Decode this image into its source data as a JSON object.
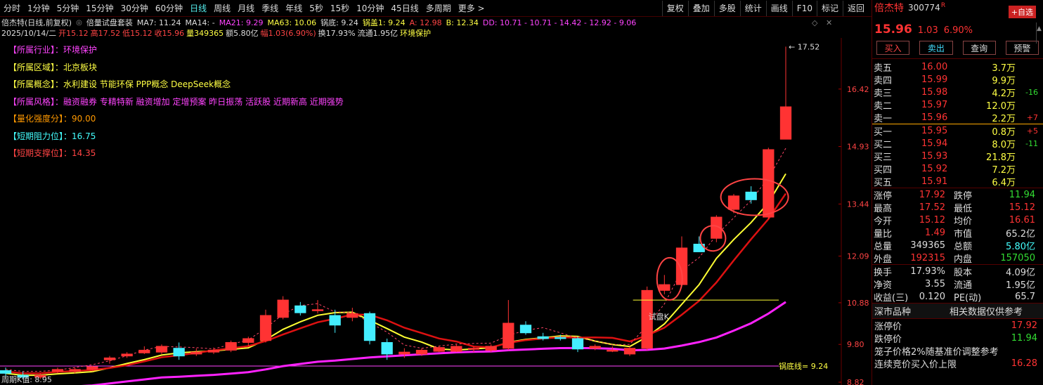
{
  "toolbar": {
    "periods": [
      "分时",
      "1分钟",
      "5分钟",
      "15分钟",
      "30分钟",
      "60分钟",
      "日线",
      "周线",
      "月线",
      "季线",
      "年线",
      "5秒",
      "15秒",
      "10分钟",
      "45日线",
      "多周期",
      "更多 >"
    ],
    "active": "日线",
    "right_items": [
      "复权",
      "叠加",
      "多股",
      "统计",
      "画线",
      "F10",
      "标记",
      "返回"
    ]
  },
  "title_line": {
    "stock": "倍杰特(日线,前复权)",
    "indicator": "倍量试盘套装",
    "ma7": "MA7: 11.24",
    "ma14": "MA14: -",
    "ma21": "MA21: 9.29",
    "ma63": "MA63: 10.06",
    "guodi": "锅底: 9.24",
    "guogai": "锅盖1: 9.24",
    "a": "A: 12.98",
    "b": "B: 12.34",
    "dd": "DD: 10.71 - 10.71 - 14.42 - 12.92 - 9.06"
  },
  "ohlc_line": {
    "date": "2025/10/14/二",
    "open": "开15.12",
    "high": "高17.52",
    "low": "低15.12",
    "close": "收15.96",
    "volume": "量349365",
    "amount": "额5.80亿",
    "change": "幅1.03(6.90%)",
    "turnover": "换17.93%",
    "float": "流通1.95亿",
    "industry": "环境保护"
  },
  "tags": [
    {
      "label": "【所属行业】：",
      "value": "环境保护",
      "color": "#ff44ff"
    },
    {
      "label": "【所属区域】：",
      "value": "北京板块",
      "color": "#ffff44"
    },
    {
      "label": "【所属概念】：",
      "value": "水利建设 节能环保 PPP概念 DeepSeek概念",
      "color": "#ffff44"
    },
    {
      "label": "【所属风格】：",
      "value": "融资融券 专精特新 融资增加 定增预案 昨日振荡 活跃股 近期新高 近期强势",
      "color": "#ff44ff"
    },
    {
      "label": "【量化强度分】：",
      "value": "90.00",
      "color": "#ff9900"
    },
    {
      "label": "【短期阻力位】：",
      "value": "16.75",
      "color": "#44ffff"
    },
    {
      "label": "【短期支撑位】：",
      "value": "14.35",
      "color": "#ff4444"
    }
  ],
  "chart_data": {
    "type": "candlestick",
    "ylim": [
      8.82,
      17.6
    ],
    "y_ticks": [
      "16.42",
      "14.93",
      "13.44",
      "12.09",
      "10.88",
      "9.80",
      "8.82"
    ],
    "candles": [
      {
        "o": 9.12,
        "h": 9.2,
        "l": 8.98,
        "c": 9.05
      },
      {
        "o": 9.0,
        "h": 9.1,
        "l": 8.9,
        "c": 8.95
      },
      {
        "o": 8.95,
        "h": 9.05,
        "l": 8.9,
        "c": 9.0
      },
      {
        "o": 9.1,
        "h": 9.2,
        "l": 9.05,
        "c": 9.15
      },
      {
        "o": 9.1,
        "h": 9.2,
        "l": 9.05,
        "c": 9.15
      },
      {
        "o": 9.15,
        "h": 9.25,
        "l": 9.1,
        "c": 9.22
      },
      {
        "o": 9.4,
        "h": 9.5,
        "l": 9.3,
        "c": 9.45
      },
      {
        "o": 9.5,
        "h": 9.6,
        "l": 9.45,
        "c": 9.55
      },
      {
        "o": 9.58,
        "h": 9.75,
        "l": 9.55,
        "c": 9.65
      },
      {
        "o": 9.6,
        "h": 9.8,
        "l": 9.55,
        "c": 9.75
      },
      {
        "o": 9.7,
        "h": 9.85,
        "l": 9.4,
        "c": 9.5
      },
      {
        "o": 9.55,
        "h": 9.7,
        "l": 9.5,
        "c": 9.6
      },
      {
        "o": 9.6,
        "h": 9.72,
        "l": 9.55,
        "c": 9.65
      },
      {
        "o": 9.65,
        "h": 9.9,
        "l": 9.6,
        "c": 9.85
      },
      {
        "o": 9.85,
        "h": 10.0,
        "l": 9.75,
        "c": 9.95
      },
      {
        "o": 9.9,
        "h": 10.7,
        "l": 9.85,
        "c": 10.55
      },
      {
        "o": 10.5,
        "h": 11.05,
        "l": 10.45,
        "c": 10.95
      },
      {
        "o": 10.8,
        "h": 10.9,
        "l": 10.55,
        "c": 10.62
      },
      {
        "o": 10.7,
        "h": 10.95,
        "l": 10.6,
        "c": 10.7
      },
      {
        "o": 10.55,
        "h": 10.7,
        "l": 10.1,
        "c": 10.3
      },
      {
        "o": 10.5,
        "h": 10.75,
        "l": 10.4,
        "c": 10.6
      },
      {
        "o": 10.6,
        "h": 10.65,
        "l": 9.8,
        "c": 9.9
      },
      {
        "o": 9.85,
        "h": 9.95,
        "l": 9.4,
        "c": 9.55
      },
      {
        "o": 9.55,
        "h": 9.7,
        "l": 9.45,
        "c": 9.6
      },
      {
        "o": 9.55,
        "h": 9.7,
        "l": 9.5,
        "c": 9.65
      },
      {
        "o": 9.62,
        "h": 9.75,
        "l": 9.6,
        "c": 9.72
      },
      {
        "o": 9.62,
        "h": 9.8,
        "l": 9.6,
        "c": 9.75
      },
      {
        "o": 9.68,
        "h": 9.75,
        "l": 9.6,
        "c": 9.7
      },
      {
        "o": 9.65,
        "h": 9.8,
        "l": 9.6,
        "c": 9.75
      },
      {
        "o": 9.7,
        "h": 10.95,
        "l": 9.65,
        "c": 10.35
      },
      {
        "o": 10.3,
        "h": 10.4,
        "l": 10.05,
        "c": 10.1
      },
      {
        "o": 10.0,
        "h": 10.1,
        "l": 9.9,
        "c": 9.95
      },
      {
        "o": 9.98,
        "h": 10.05,
        "l": 9.9,
        "c": 9.95
      },
      {
        "o": 9.95,
        "h": 10.0,
        "l": 9.6,
        "c": 9.68
      },
      {
        "o": 9.7,
        "h": 9.8,
        "l": 9.65,
        "c": 9.75
      },
      {
        "o": 9.65,
        "h": 9.75,
        "l": 9.6,
        "c": 9.65
      },
      {
        "o": 9.55,
        "h": 9.75,
        "l": 9.5,
        "c": 9.7
      },
      {
        "o": 9.7,
        "h": 11.3,
        "l": 9.65,
        "c": 11.2
      },
      {
        "o": 11.2,
        "h": 11.6,
        "l": 11.1,
        "c": 11.35
      },
      {
        "o": 11.35,
        "h": 12.6,
        "l": 11.3,
        "c": 12.3
      },
      {
        "o": 12.4,
        "h": 12.6,
        "l": 12.2,
        "c": 12.2
      },
      {
        "o": 12.55,
        "h": 13.15,
        "l": 12.45,
        "c": 13.1
      },
      {
        "o": 13.3,
        "h": 13.7,
        "l": 13.2,
        "c": 13.65
      },
      {
        "o": 13.75,
        "h": 13.9,
        "l": 13.45,
        "c": 13.55
      },
      {
        "o": 13.1,
        "h": 14.9,
        "l": 13.05,
        "c": 14.85
      },
      {
        "o": 15.12,
        "h": 17.52,
        "l": 15.12,
        "c": 15.96
      }
    ],
    "annotations": [
      "17.52",
      "试盘K",
      "锅底线= 9.24",
      "周期K值: 8.95"
    ]
  },
  "panel": {
    "name": "倍杰特",
    "code": "300774",
    "code_suffix": "R",
    "add_btn": "+自选",
    "price": "15.96",
    "change": "1.03",
    "pct": "6.90%",
    "buttons": [
      "买入",
      "卖出",
      "查询",
      "预警"
    ],
    "asks": [
      {
        "label": "卖五",
        "price": "16.00",
        "vol": "3.7万",
        "delta": ""
      },
      {
        "label": "卖四",
        "price": "15.99",
        "vol": "9.9万",
        "delta": ""
      },
      {
        "label": "卖三",
        "price": "15.98",
        "vol": "4.2万",
        "delta": "-16"
      },
      {
        "label": "卖二",
        "price": "15.97",
        "vol": "12.0万",
        "delta": ""
      },
      {
        "label": "卖一",
        "price": "15.96",
        "vol": "2.2万",
        "delta": "+7"
      }
    ],
    "bids": [
      {
        "label": "买一",
        "price": "15.95",
        "vol": "0.8万",
        "delta": "+5"
      },
      {
        "label": "买二",
        "price": "15.94",
        "vol": "8.0万",
        "delta": "-11"
      },
      {
        "label": "买三",
        "price": "15.93",
        "vol": "21.8万",
        "delta": ""
      },
      {
        "label": "买四",
        "price": "15.92",
        "vol": "7.2万",
        "delta": ""
      },
      {
        "label": "买五",
        "price": "15.91",
        "vol": "6.4万",
        "delta": ""
      }
    ],
    "stats": [
      {
        "l1": "涨停",
        "v1": "17.92",
        "c1": "#ff3333",
        "l2": "跌停",
        "v2": "11.94",
        "c2": "#33dd33"
      },
      {
        "l1": "最高",
        "v1": "17.52",
        "c1": "#ff3333",
        "l2": "最低",
        "v2": "15.12",
        "c2": "#ff3333"
      },
      {
        "l1": "今开",
        "v1": "15.12",
        "c1": "#ff3333",
        "l2": "均价",
        "v2": "16.61",
        "c2": "#ff3333"
      },
      {
        "l1": "量比",
        "v1": "1.49",
        "c1": "#ff3333",
        "l2": "市值",
        "v2": "65.2亿",
        "c2": "#dddddd"
      },
      {
        "l1": "总量",
        "v1": "349365",
        "c1": "#dddddd",
        "l2": "总额",
        "v2": "5.80亿",
        "c2": "#44ffff"
      },
      {
        "l1": "外盘",
        "v1": "192315",
        "c1": "#ff3333",
        "l2": "内盘",
        "v2": "157050",
        "c2": "#33dd33"
      }
    ],
    "stats2": [
      {
        "l1": "换手",
        "v1": "17.93%",
        "l2": "股本",
        "v2": "4.09亿"
      },
      {
        "l1": "净资",
        "v1": "3.55",
        "l2": "流通",
        "v2": "1.95亿"
      },
      {
        "l1": "收益(三)",
        "v1": "0.120",
        "l2": "PE(动)",
        "v2": "65.7"
      }
    ],
    "section_title": "深市品种",
    "section_right": "相关数据仅供参考",
    "limit_up_label": "涨停价",
    "limit_up": "17.92",
    "limit_down_label": "跌停价",
    "limit_down": "11.94",
    "cage_text": "笼子价格2%随基准价调整参考",
    "cont_label": "连续竞价买入价上限",
    "cont_value": "16.28"
  }
}
